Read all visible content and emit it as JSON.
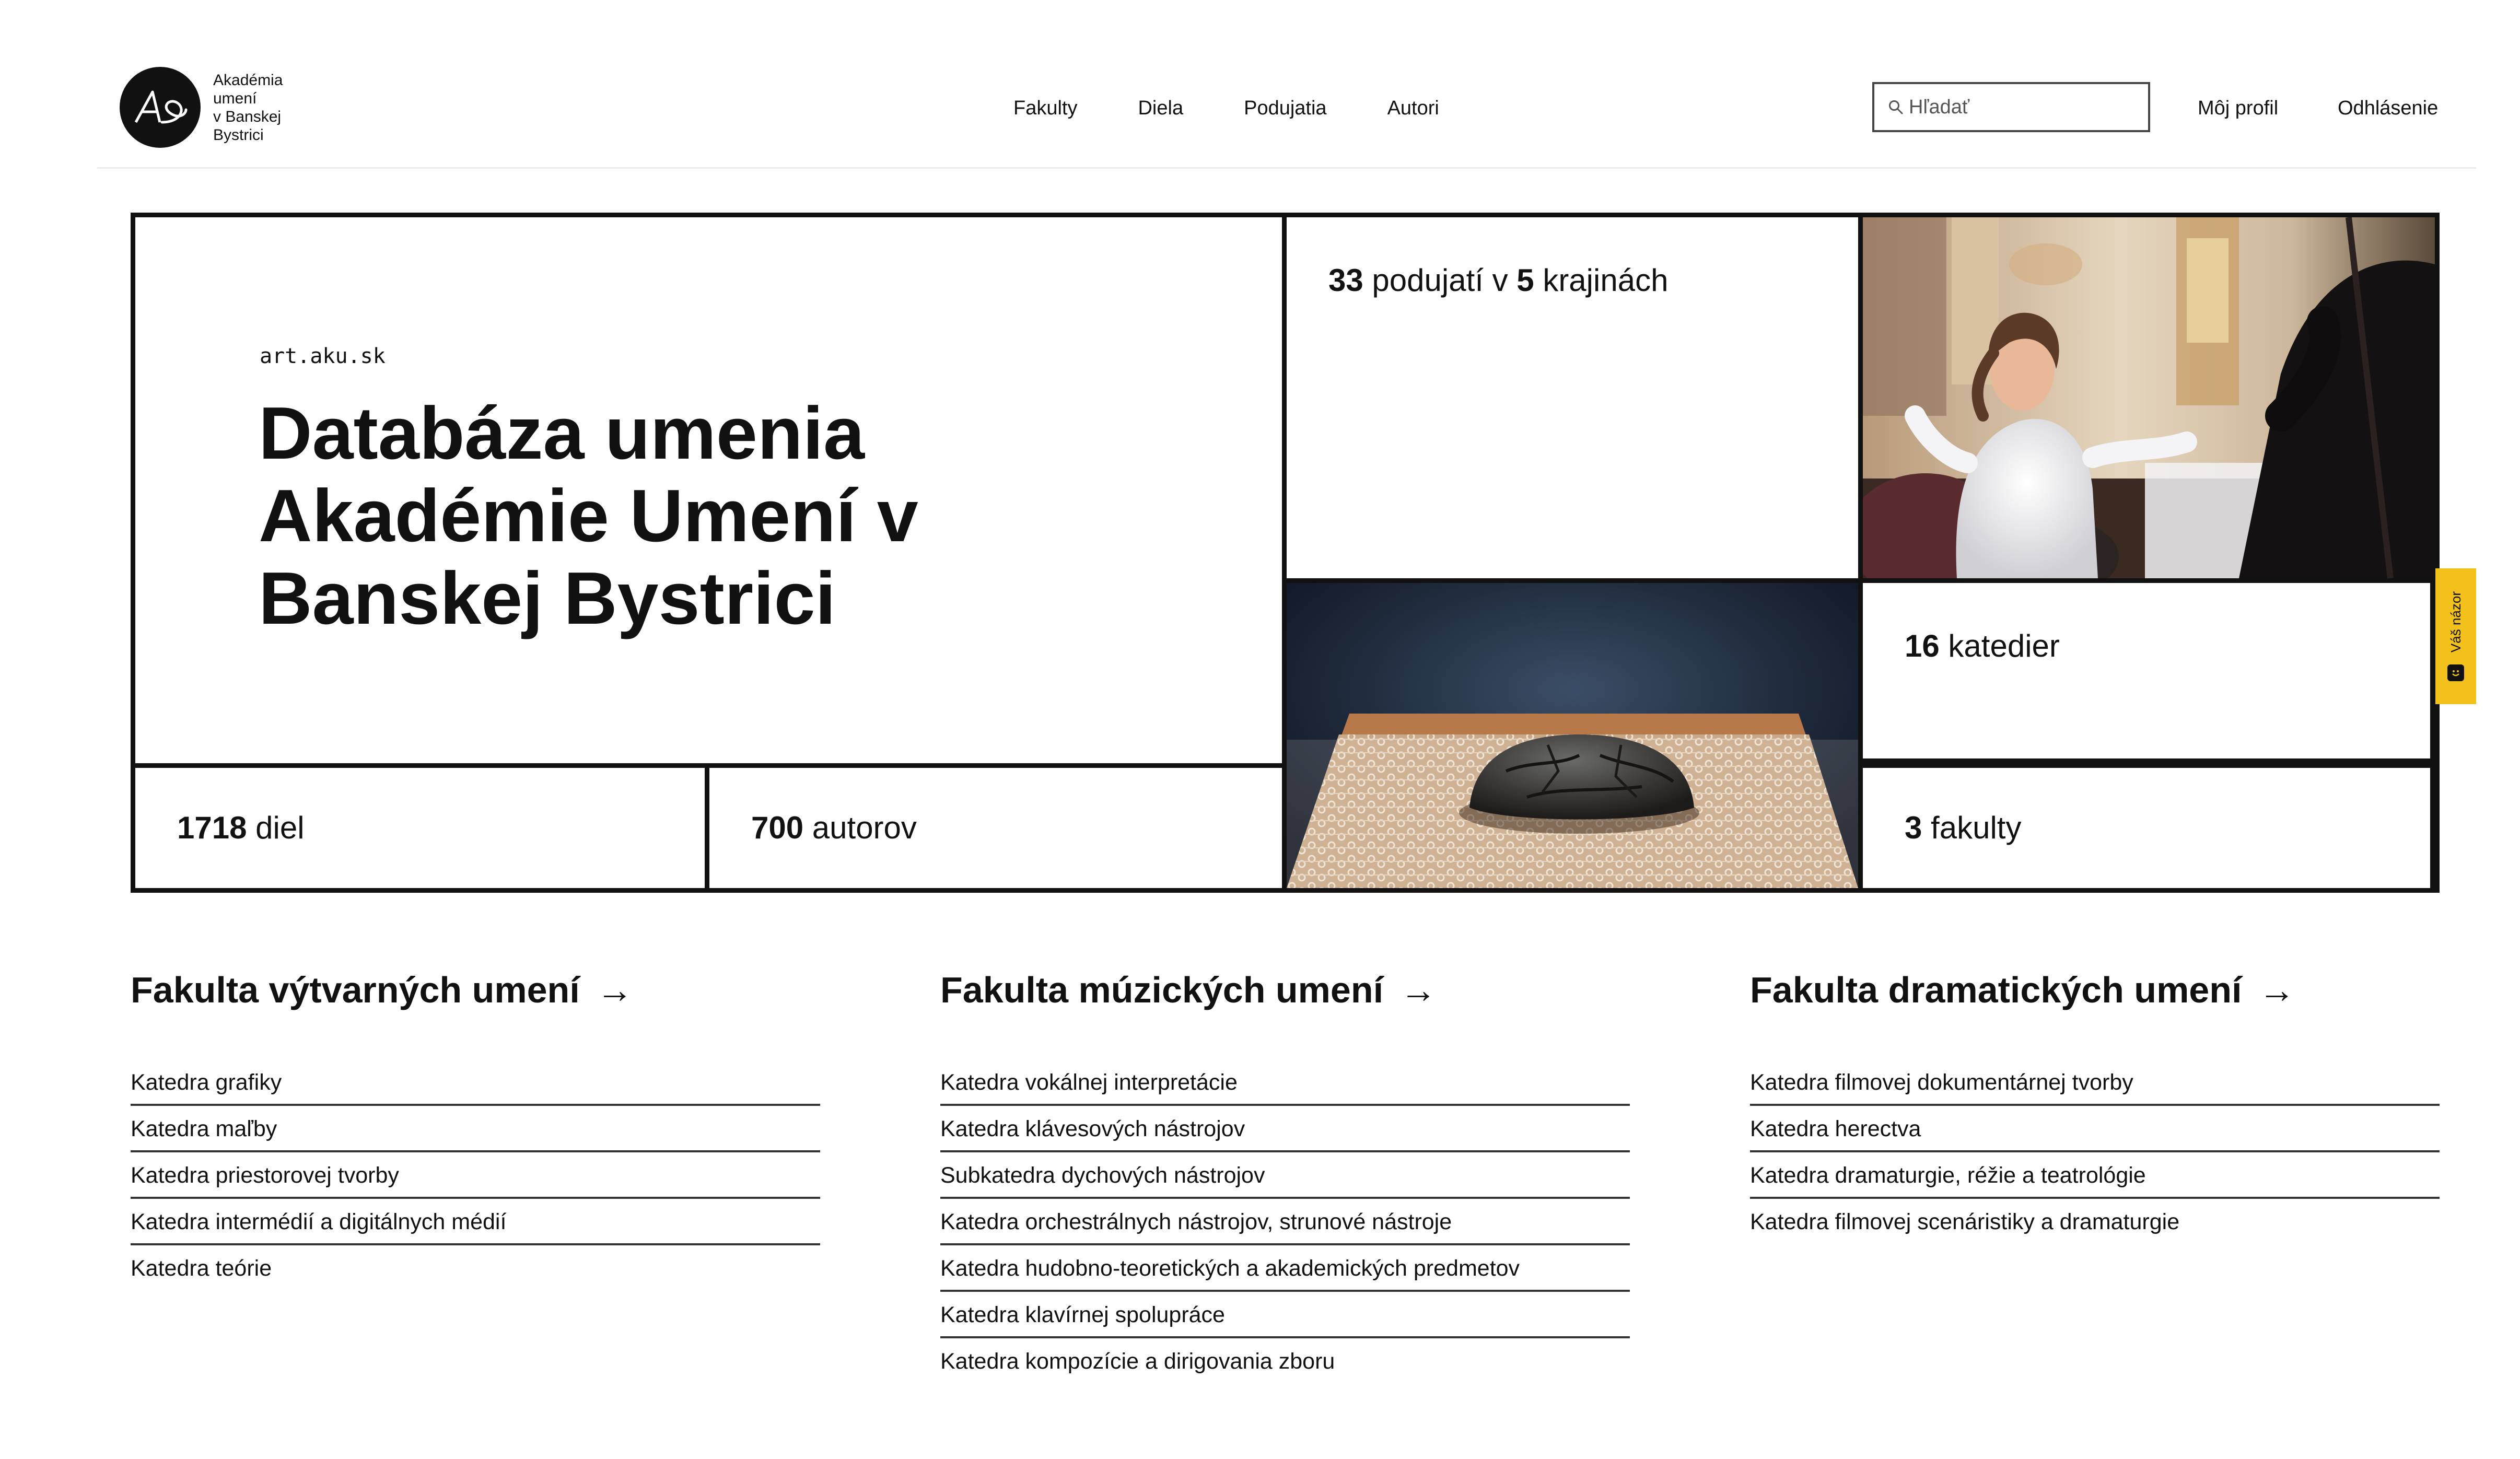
{
  "header": {
    "logo_lines": [
      "Akadémia",
      "umení",
      "v Banskej",
      "Bystrici"
    ],
    "nav": [
      "Fakulty",
      "Diela",
      "Podujatia",
      "Autori"
    ],
    "search_placeholder": "Hľadať",
    "profile_label": "Môj profil",
    "logout_label": "Odhlásenie"
  },
  "hero": {
    "url": "art.aku.sk",
    "title": "Databáza umenia Akadémie Umení v Banskej Bystrici",
    "stats": {
      "events": {
        "count": "33",
        "mid": " podujatí v ",
        "regions": "5",
        "tail": " krajinách"
      },
      "works": {
        "count": "1718",
        "label": " diel"
      },
      "authors": {
        "count": "700",
        "label": " autorov"
      },
      "departments": {
        "count": "16",
        "label": " katedier"
      },
      "faculties": {
        "count": "3",
        "label": " fakulty"
      }
    }
  },
  "feedback": {
    "label": "Váš názor"
  },
  "faculties": [
    {
      "title": "Fakulta výtvarných umení",
      "arrow": "→",
      "departments": [
        "Katedra grafiky",
        "Katedra maľby",
        "Katedra priestorovej tvorby",
        "Katedra intermédií a digitálnych médií",
        "Katedra teórie"
      ]
    },
    {
      "title": "Fakulta múzických umení",
      "arrow": "→",
      "departments": [
        "Katedra vokálnej interpretácie",
        "Katedra klávesových nástrojov",
        "Subkatedra dychových nástrojov",
        "Katedra orchestrálnych nástrojov, strunové nástroje",
        "Katedra hudobno-teoretických a akademických predmetov",
        "Katedra klavírnej spolupráce",
        "Katedra kompozície a dirigovania zboru"
      ]
    },
    {
      "title": "Fakulta dramatických umení",
      "arrow": "→",
      "departments": [
        "Katedra filmovej dokumentárnej tvorby",
        "Katedra herectva",
        "Katedra dramaturgie, réžie a teatrológie",
        "Katedra filmovej scenáristiky a dramaturgie"
      ]
    }
  ]
}
